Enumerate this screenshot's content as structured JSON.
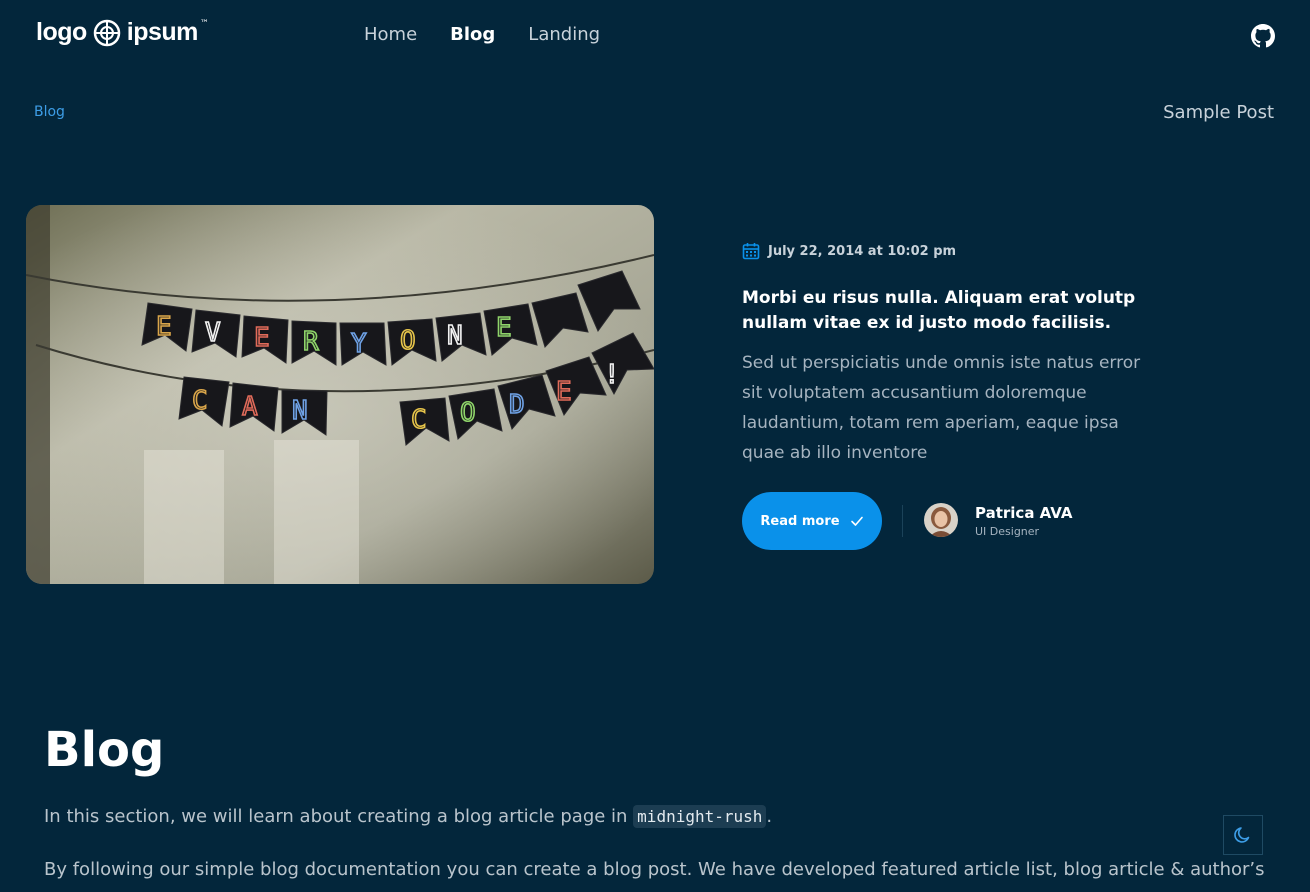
{
  "header": {
    "logo_left": "logo",
    "logo_right": "ipsum",
    "nav": [
      {
        "label": "Home"
      },
      {
        "label": "Blog"
      },
      {
        "label": "Landing"
      }
    ]
  },
  "breadcrumb": {
    "left": "Blog",
    "right": "Sample Post"
  },
  "featured": {
    "date": "July 22, 2014 at 10:02 pm",
    "title": "Morbi eu risus nulla. Aliquam erat volutp nullam vitae ex id justo modo facilisis.",
    "excerpt": "Sed ut perspiciatis unde omnis iste natus error sit voluptatem accusantium doloremque laudantium, totam rem aperiam, eaque ipsa quae ab illo inventore",
    "read_more": "Read more",
    "author_name": "Patrica AVA",
    "author_role": "UI Designer",
    "image_banner_top": "EVERYONE",
    "image_banner_bottom": "CAN CODE!"
  },
  "blog_section": {
    "title": "Blog",
    "intro_prefix": "In this section, we will learn about creating a blog article page in ",
    "intro_code": "midnight-rush",
    "intro_suffix": ".",
    "paragraph": "By following our simple blog documentation you can create a blog post. We have developed featured article list, blog article & author’s"
  },
  "icons": {
    "calendar": "calendar-icon",
    "check": "check-icon",
    "github": "github-icon",
    "moon": "moon-icon"
  },
  "colors": {
    "background": "#03263b",
    "accent": "#0a91ea",
    "link": "#3d9de6"
  }
}
